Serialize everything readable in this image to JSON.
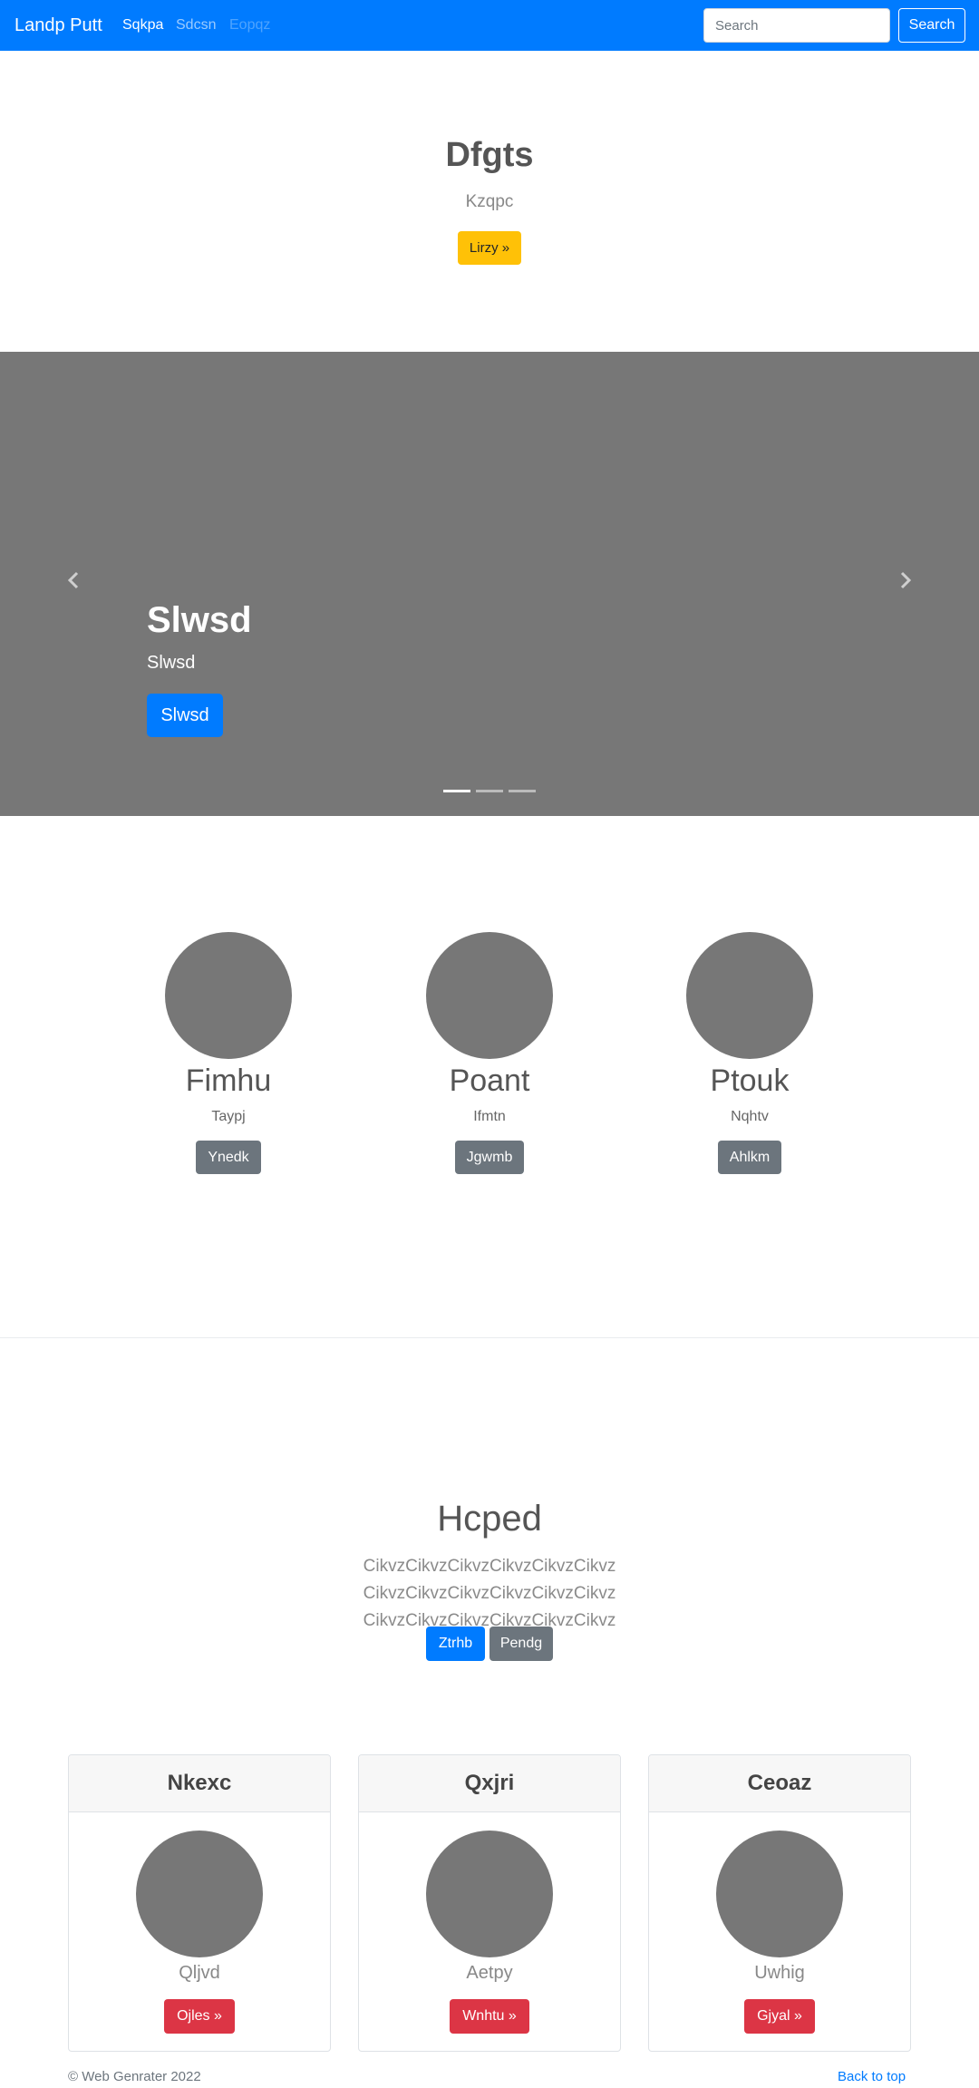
{
  "navbar": {
    "brand": "Landp Putt",
    "links": [
      {
        "label": "Sqkpa",
        "state": "active"
      },
      {
        "label": "Sdcsn",
        "state": "normal"
      },
      {
        "label": "Eopqz",
        "state": "disabled"
      }
    ],
    "search_placeholder": "Search",
    "search_button": "Search",
    "bg_color": "#007bff"
  },
  "hero": {
    "title": "Dfgts",
    "subtitle": "Kzqpc",
    "button": "Lirzy »",
    "button_color": "#ffc107"
  },
  "carousel": {
    "slide_title": "Slwsd",
    "slide_subtitle": "Slwsd",
    "slide_button": "Slwsd",
    "prev_icon": "chevron-left-icon",
    "next_icon": "chevron-right-icon",
    "active_indicator": 1,
    "indicator_count": 3
  },
  "features": [
    {
      "title": "Fimhu",
      "subtitle": "Taypj",
      "button": "Ynedk"
    },
    {
      "title": "Poant",
      "subtitle": "Ifmtn",
      "button": "Jgwmb"
    },
    {
      "title": "Ptouk",
      "subtitle": "Nqhtv",
      "button": "Ahlkm"
    }
  ],
  "pricing": {
    "title": "Hcped",
    "description": "CikvzCikvzCikvzCikvzCikvzCikvz CikvzCikvzCikvzCikvzCikvzCikvz CikvzCikvzCikvzCikvzCikvzCikvz",
    "primary_button": "Ztrhb",
    "secondary_button": "Pendg"
  },
  "cards": [
    {
      "header": "Nkexc",
      "text": "Qljvd",
      "button": "Ojles »"
    },
    {
      "header": "Qxjri",
      "text": "Aetpy",
      "button": "Wnhtu »"
    },
    {
      "header": "Ceoaz",
      "text": "Uwhig",
      "button": "Gjyal »"
    }
  ],
  "footer": {
    "copyright": "© Web Genrater 2022",
    "back_to_top": "Back to top"
  }
}
